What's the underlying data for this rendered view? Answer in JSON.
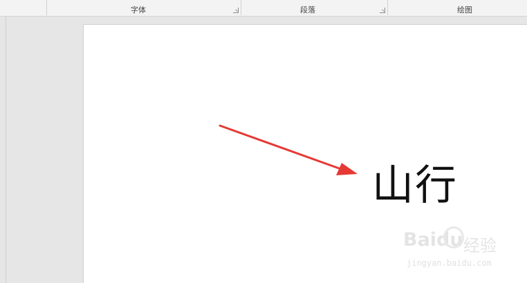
{
  "ribbon": {
    "groups": [
      {
        "label": "字体"
      },
      {
        "label": "段落"
      },
      {
        "label": "绘图"
      }
    ]
  },
  "document": {
    "text": "山行"
  },
  "annotation": {
    "color": "#e53935"
  },
  "watermark": {
    "logo": "Baidu",
    "cn": "经验",
    "url": "jingyan.baidu.com"
  }
}
